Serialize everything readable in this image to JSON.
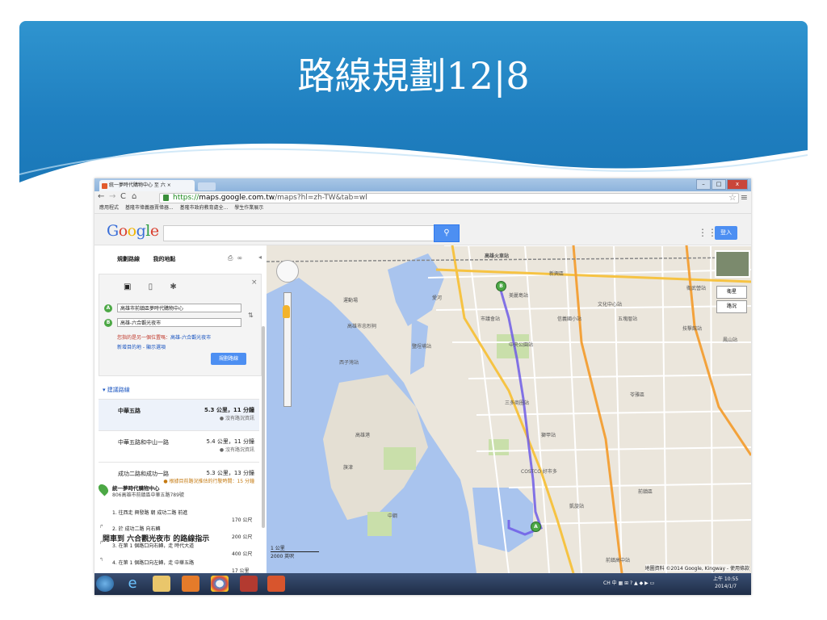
{
  "slide": {
    "title": "路線規劃12|8"
  },
  "browser": {
    "tab_title": "統一夢時代購物中心 至 六 ×",
    "url_https": "https://",
    "url_host": "maps.google.com.tw",
    "url_path": "/maps?hl=zh-TW&tab=wl",
    "bookmarks": [
      "應用程式",
      "基隆市偉義器賣偉器...",
      "基隆市政府教育處全...",
      "學生作業展示"
    ],
    "window_buttons": [
      "–",
      "□",
      "x"
    ]
  },
  "google": {
    "logo": "Google",
    "search_placeholder": "",
    "login_label": "登入",
    "search_icon": "search-icon",
    "apps_icon": "grid-icon"
  },
  "panel": {
    "tabs": [
      "規劃路線",
      "我的地點"
    ],
    "origin": "高雄市前鎮區夢時代購物中心",
    "destination": "高雄-六合觀光夜市",
    "warning_prefix": "您指的是另一個位置嗎：",
    "warning_link": "高雄-六合觀光夜市",
    "add_destination": "新增目的地 - 顯示選項",
    "go_button": "規劃路線",
    "suggested_label": "建議路線",
    "routes": [
      {
        "name": "中華五路",
        "dist": "5.3 公里，11 分鐘",
        "traffic": "● 沒有路況資訊"
      },
      {
        "name": "中華五路和中山一路",
        "dist": "5.4 公里，11 分鐘",
        "traffic": "● 沒有路況資訊"
      },
      {
        "name": "成功二路和成功一路",
        "dist": "5.3 公里，13 分鐘",
        "traffic": "● 根據目前路況推估的行駛時間：15 分鐘"
      }
    ],
    "directions_title": "開車到 六合觀光夜市 的路線指示",
    "start_name": "統一夢時代購物中心",
    "start_addr": "806高雄市前鎮區中華五路789號",
    "steps": [
      {
        "text": "1. 往西走 興發路 朝 成功二路 前進",
        "dist": "170 公尺"
      },
      {
        "text": "2. 於 成功二路 向右轉",
        "dist": "200 公尺"
      },
      {
        "text": "3. 在第 1 個路口向右轉，走 時代大道",
        "dist": "400 公尺"
      },
      {
        "text": "4. 在第 1 個路口向左轉，走 中華五路",
        "dist": "17 公里"
      }
    ]
  },
  "map": {
    "labels": [
      "高雄火車站",
      "美麗島站",
      "信義國小站",
      "文化中心站",
      "五塊厝站",
      "技擊館站",
      "衛武營站",
      "鳳山站",
      "中央公園站",
      "市議會站",
      "鹽埕埔站",
      "西子灣站",
      "三多商圈站",
      "獅甲站",
      "凱旋站",
      "前鎮高中站",
      "愛河",
      "高雄港",
      "旗津",
      "中鋼",
      "COSTCO 好市多",
      "苓雅區",
      "新興區",
      "前鎮區",
      "運動場",
      "高雄市忠烈祠"
    ],
    "map_types": [
      "衛星",
      "路況"
    ],
    "scale_km": "1 公里",
    "scale_ft": "2000 英呎",
    "copyright": "地圖資料 ©2014 Google, Kingway - 使用條款"
  },
  "taskbar": {
    "tray": "CH 中 ▦ ⊞ ? ▲ ◆ ▶ ▭",
    "time": "上午 10:55",
    "date": "2014/1/7"
  }
}
